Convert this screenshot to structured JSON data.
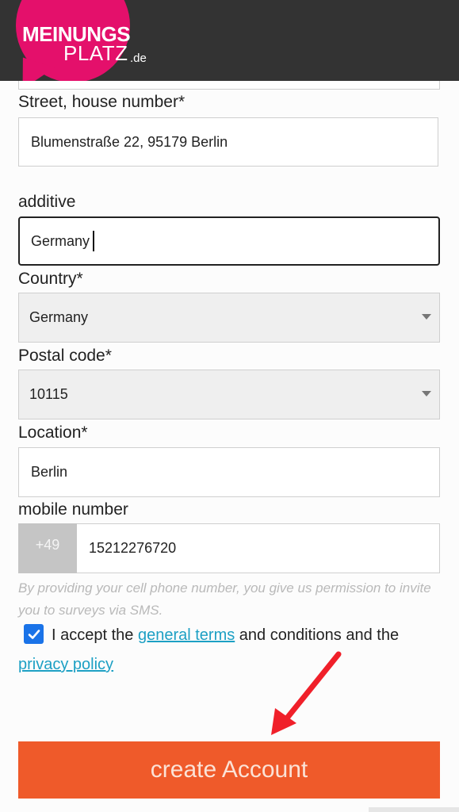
{
  "header": {
    "logo_line1": "MEINUNGS",
    "logo_line2": "PLATZ",
    "logo_tld": ".de",
    "brand_color": "#e4106b",
    "bar_color": "#333333"
  },
  "form": {
    "street": {
      "label": "Street, house number*",
      "value": "Blumenstraße 22, 95179 Berlin"
    },
    "additive": {
      "label": "additive",
      "value": "Germany"
    },
    "country": {
      "label": "Country*",
      "value": "Germany"
    },
    "postal": {
      "label": "Postal code*",
      "value": "10115"
    },
    "location": {
      "label": "Location*",
      "value": "Berlin"
    },
    "mobile": {
      "label": "mobile number",
      "prefix": "+49",
      "value": "15212276720",
      "hint": "By providing your cell phone number, you give us permission to invite you to surveys via SMS."
    },
    "terms": {
      "checked": true,
      "text_before": "I accept the ",
      "link1": "general terms",
      "text_middle": " and conditions and the ",
      "link2": "privacy policy"
    },
    "submit_label": "create Account",
    "submit_color": "#ef5a2a",
    "annotation_arrow_color": "#f0202a"
  }
}
